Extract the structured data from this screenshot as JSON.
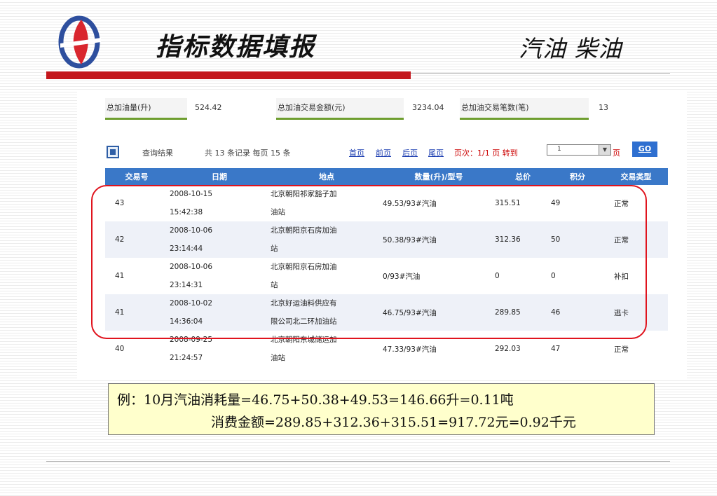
{
  "header": {
    "title": "指标数据填报",
    "fuel_types": "汽油 柴油",
    "colors": {
      "accent": "#c4161c",
      "table_header": "#3a78c8"
    }
  },
  "summary": [
    {
      "label": "总加油量(升)",
      "value": "524.42"
    },
    {
      "label": "总加油交易金额(元)",
      "value": "3234.04"
    },
    {
      "label": "总加油交易笔数(笔)",
      "value": "13"
    }
  ],
  "query": {
    "icon": "fuel-pump-icon",
    "result_label": "查询结果",
    "record_info": "共 13 条记录 每页 15 条",
    "nav": {
      "first": "首页",
      "prev": "前页",
      "next": "后页",
      "last": "尾页"
    },
    "page_info": "页次：1/1 页 转到",
    "page_select": "1",
    "page_suffix": "页",
    "go": "GO"
  },
  "table": {
    "headers": [
      "交易号",
      "日期",
      "地点",
      "数量(升)/型号",
      "总价",
      "积分",
      "交易类型"
    ],
    "rows": [
      {
        "id": "43",
        "date": "2008-10-15",
        "time": "15:42:38",
        "loc1": "北京朝阳祁家豁子加",
        "loc2": "油站",
        "qty": "49.53/93#汽油",
        "total": "315.51",
        "points": "49",
        "type": "正常"
      },
      {
        "id": "42",
        "date": "2008-10-06",
        "time": "23:14:44",
        "loc1": "北京朝阳京石房加油",
        "loc2": "站",
        "qty": "50.38/93#汽油",
        "total": "312.36",
        "points": "50",
        "type": "正常"
      },
      {
        "id": "41",
        "date": "2008-10-06",
        "time": "23:14:31",
        "loc1": "北京朝阳京石房加油",
        "loc2": "站",
        "qty": "0/93#汽油",
        "total": "0",
        "points": "0",
        "type": "补扣"
      },
      {
        "id": "41",
        "date": "2008-10-02",
        "time": "14:36:04",
        "loc1": "北京好运油料供应有",
        "loc2": "限公司北二环加油站",
        "qty": "46.75/93#汽油",
        "total": "289.85",
        "points": "46",
        "type": "逃卡"
      },
      {
        "id": "40",
        "date": "2008-09-25",
        "time": "21:24:57",
        "loc1": "北京朝阳东城储运加",
        "loc2": "油站",
        "qty": "47.33/93#汽油",
        "total": "292.03",
        "points": "47",
        "type": "正常"
      }
    ]
  },
  "note": {
    "line1": "例：10月汽油消耗量=46.75+50.38+49.53=146.66升=0.11吨",
    "line2": "消费金额=289.85+312.36+315.51=917.72元=0.92千元"
  }
}
